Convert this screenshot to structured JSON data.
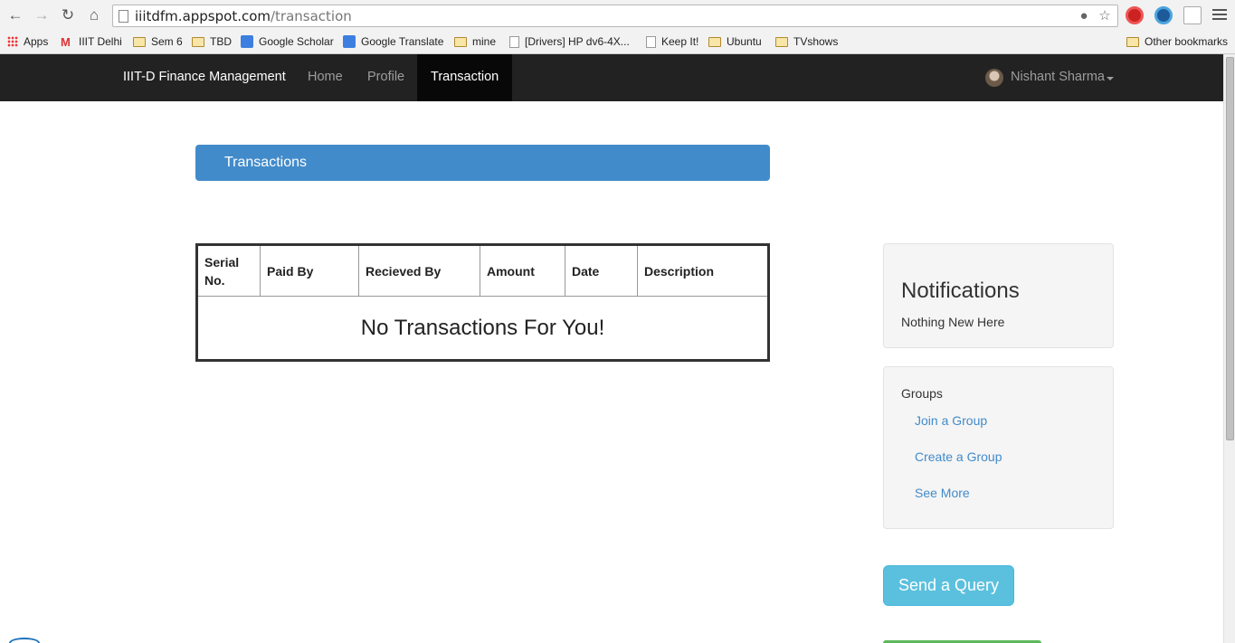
{
  "browser": {
    "url_host": "iiitdfm.appspot.com",
    "url_path": "/transaction",
    "bookmarks": [
      {
        "label": "Apps",
        "icon": "apps-icon"
      },
      {
        "label": "IIIT Delhi",
        "icon": "gmail-icon"
      },
      {
        "label": "Sem 6",
        "icon": "folder-icon"
      },
      {
        "label": "TBD",
        "icon": "folder-icon"
      },
      {
        "label": "Google Scholar",
        "icon": "scholar-icon"
      },
      {
        "label": "Google Translate",
        "icon": "translate-icon"
      },
      {
        "label": "mine",
        "icon": "folder-icon"
      },
      {
        "label": "[Drivers] HP dv6-4X...",
        "icon": "page-icon"
      },
      {
        "label": "Keep It!",
        "icon": "page-icon"
      },
      {
        "label": "Ubuntu",
        "icon": "folder-icon"
      },
      {
        "label": "TVshows",
        "icon": "folder-icon"
      }
    ],
    "other_bookmarks": "Other bookmarks"
  },
  "navbar": {
    "brand": "IIIT-D Finance Management",
    "links": [
      "Home",
      "Profile"
    ],
    "active": "Transaction",
    "user": "Nishant Sharma"
  },
  "main": {
    "title": "Transactions",
    "table": {
      "headers": [
        "Serial No.",
        "Paid By",
        "Recieved By",
        "Amount",
        "Date",
        "Description"
      ],
      "empty_message": "No Transactions For You!"
    }
  },
  "sidebar": {
    "notifications": {
      "title": "Notifications",
      "text": "Nothing New Here"
    },
    "groups": {
      "title": "Groups",
      "links": [
        "Join a Group",
        "Create a Group",
        "See More"
      ]
    },
    "query_button": "Send a Query"
  },
  "colors": {
    "navbar_bg": "#222222",
    "primary": "#428bca",
    "info": "#5bc0de"
  }
}
